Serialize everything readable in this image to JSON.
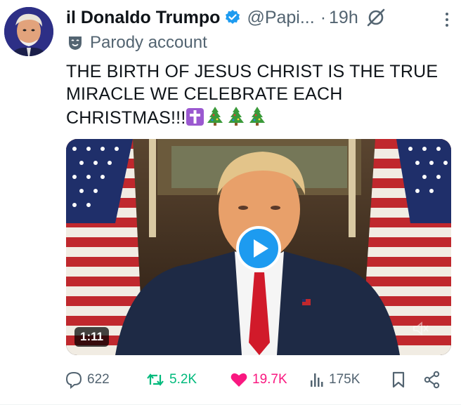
{
  "post": {
    "display_name": "il Donaldo Trumpo",
    "handle": "@Papi...",
    "separator": "·",
    "time": "19h",
    "label": "Parody account",
    "text_lines": [
      "THE BIRTH OF JESUS CHRIST IS THE TRUE",
      "MIRACLE WE CELEBRATE EACH",
      "CHRISTMAS!!!"
    ],
    "emojis": [
      "latin-cross",
      "christmas-tree",
      "christmas-tree",
      "christmas-tree"
    ]
  },
  "media": {
    "duration": "1:11"
  },
  "actions": {
    "replies": "622",
    "reposts": "5.2K",
    "likes": "19.7K",
    "views": "175K"
  },
  "colors": {
    "accent": "#1d9bf0",
    "like": "#f91880",
    "repost": "#00ba7c",
    "secondary_text": "#536471"
  }
}
